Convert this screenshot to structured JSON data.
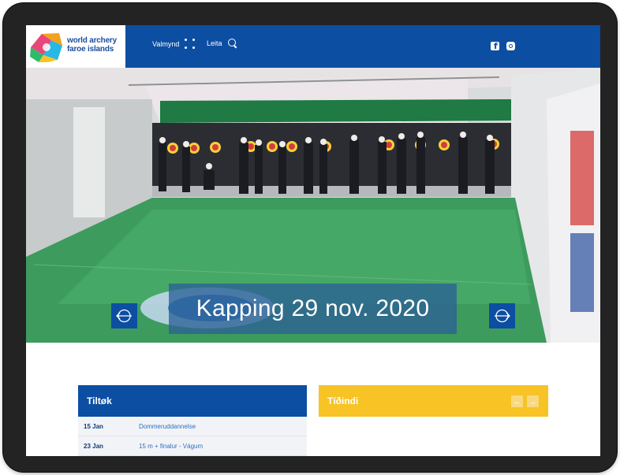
{
  "brand": {
    "line1": "world archery",
    "line2": "faroe islands",
    "colors": {
      "blue": "#0c4ea2",
      "yellow": "#f7c325",
      "pink": "#e8477a",
      "green": "#2dbb6a",
      "cyan": "#27b8e6",
      "orange": "#f4a11c"
    }
  },
  "nav": {
    "menu_label": "Valmynd",
    "menu_icon": "grid-dots-icon",
    "search_label": "Leita",
    "search_icon": "search-icon"
  },
  "social": [
    "facebook-icon",
    "instagram-icon"
  ],
  "hero": {
    "caption": "Kapping 29 nov. 2020",
    "prev_icon": "target-arrow-left-icon",
    "next_icon": "target-arrow-right-icon"
  },
  "events": {
    "title": "Tiltøk",
    "items": [
      {
        "date": "15 Jan",
        "title": "Dommeruddannelse"
      },
      {
        "date": "23 Jan",
        "title": "15 m + finalur - Vágum"
      }
    ]
  },
  "news": {
    "title": "Tíðindi",
    "prev": "←",
    "next": "→"
  }
}
